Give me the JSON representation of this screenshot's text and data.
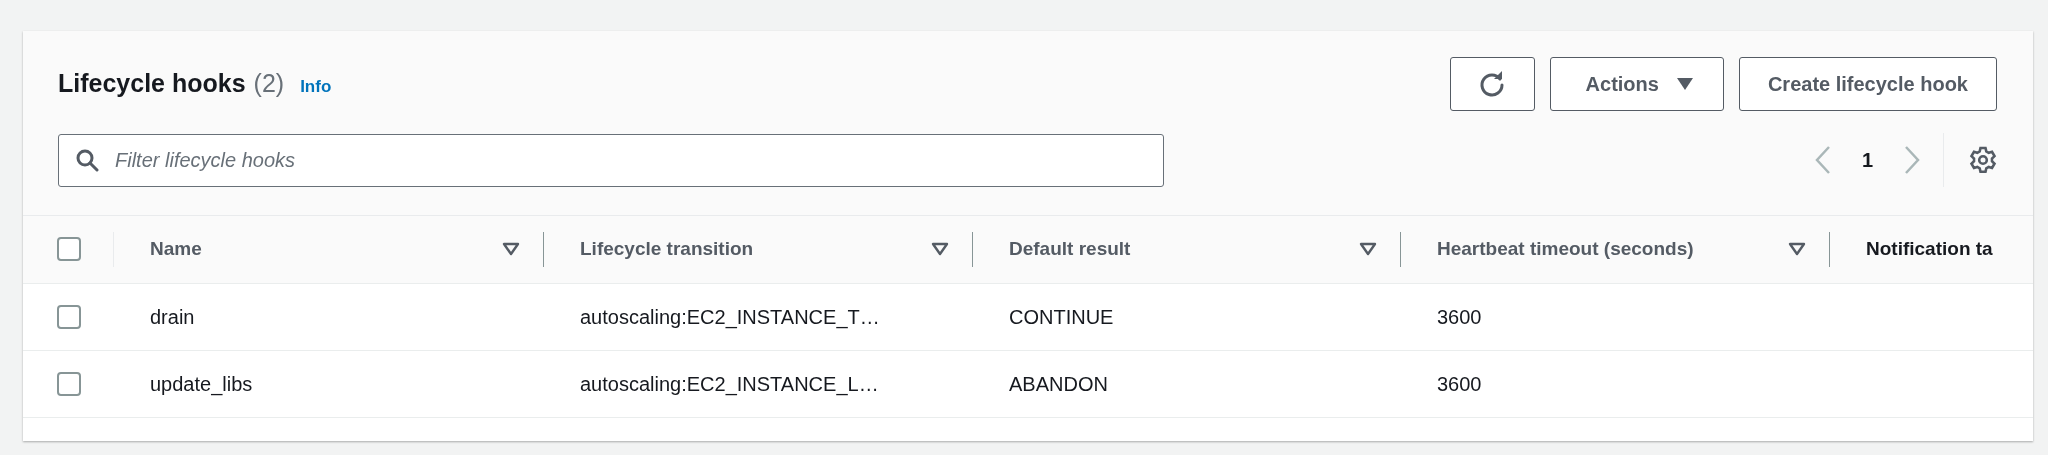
{
  "header": {
    "title": "Lifecycle hooks",
    "count": "(2)",
    "info_link": "Info"
  },
  "toolbar": {
    "buttons": [
      {
        "kind": "refresh"
      },
      {
        "kind": "dropdown",
        "label": "Actions"
      },
      {
        "kind": "plain",
        "label": "Create lifecycle hook"
      }
    ]
  },
  "filter": {
    "placeholder": "Filter lifecycle hooks"
  },
  "pagination": {
    "page": "1",
    "prev_disabled": true,
    "next_disabled": true
  },
  "table": {
    "select_all_checked": false,
    "columns": [
      {
        "label": "Name",
        "sortable": true,
        "highlighted": false
      },
      {
        "label": "Lifecycle transition",
        "sortable": true,
        "highlighted": false
      },
      {
        "label": "Default result",
        "sortable": true,
        "highlighted": false
      },
      {
        "label": "Heartbeat timeout (seconds)",
        "sortable": true,
        "highlighted": false
      },
      {
        "label": "Notification ta",
        "sortable": false,
        "highlighted": true
      }
    ],
    "rows": [
      {
        "selected": false,
        "cells": [
          "drain",
          "autoscaling:EC2_INSTANCE_T…",
          "CONTINUE",
          "3600"
        ]
      },
      {
        "selected": false,
        "cells": [
          "update_libs",
          "autoscaling:EC2_INSTANCE_L…",
          "ABANDON",
          "3600"
        ]
      }
    ]
  }
}
